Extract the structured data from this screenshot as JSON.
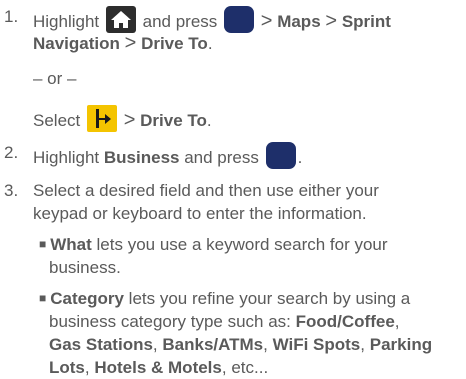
{
  "steps": [
    {
      "number": "1.",
      "line1": {
        "a": "Highlight",
        "b": "and press",
        "c": ">",
        "d": "Maps",
        "e": ">",
        "f": "Sprint"
      },
      "line2": {
        "a": "Navigation",
        "b": ">",
        "c": "Drive To",
        "d": "."
      },
      "or_text": "– or –",
      "select_line": {
        "a": "Select",
        "b": ">",
        "c": "Drive To",
        "d": "."
      }
    },
    {
      "number": "2.",
      "line1": {
        "a": "Highlight",
        "b": "Business",
        "c": "and press",
        "d": "."
      }
    },
    {
      "number": "3.",
      "line1": "Select a desired field and then use either your",
      "line2": "keypad or keyboard to enter the information."
    }
  ],
  "bullets": [
    {
      "title": "What",
      "line1_rest": " lets you use a keyword search for your",
      "line2": "business."
    },
    {
      "title": "Category",
      "line1_rest": " lets you refine your search by using a",
      "line2_pre": "business category type such as: ",
      "cat1": "Food/Coffee",
      "comma1": ",",
      "cat2": "Gas Stations",
      "comma2": ", ",
      "cat3": "Banks/ATMs",
      "comma3": ", ",
      "cat4": "WiFi Spots",
      "comma4": ", ",
      "cat5": "Parking",
      "cat5b": "Lots",
      "comma5": ", ",
      "cat6": "Hotels & Motels",
      "tail": ", etc..."
    }
  ],
  "icons": {
    "home": "home-icon",
    "key": "ok-key-icon",
    "navigation": "navigation-icon"
  },
  "colors": {
    "text": "#5a5a5a",
    "home_icon_bg": "#2d2d2d",
    "key_bg": "#1e2f6a",
    "nav_icon_bg": "#f4c400"
  }
}
